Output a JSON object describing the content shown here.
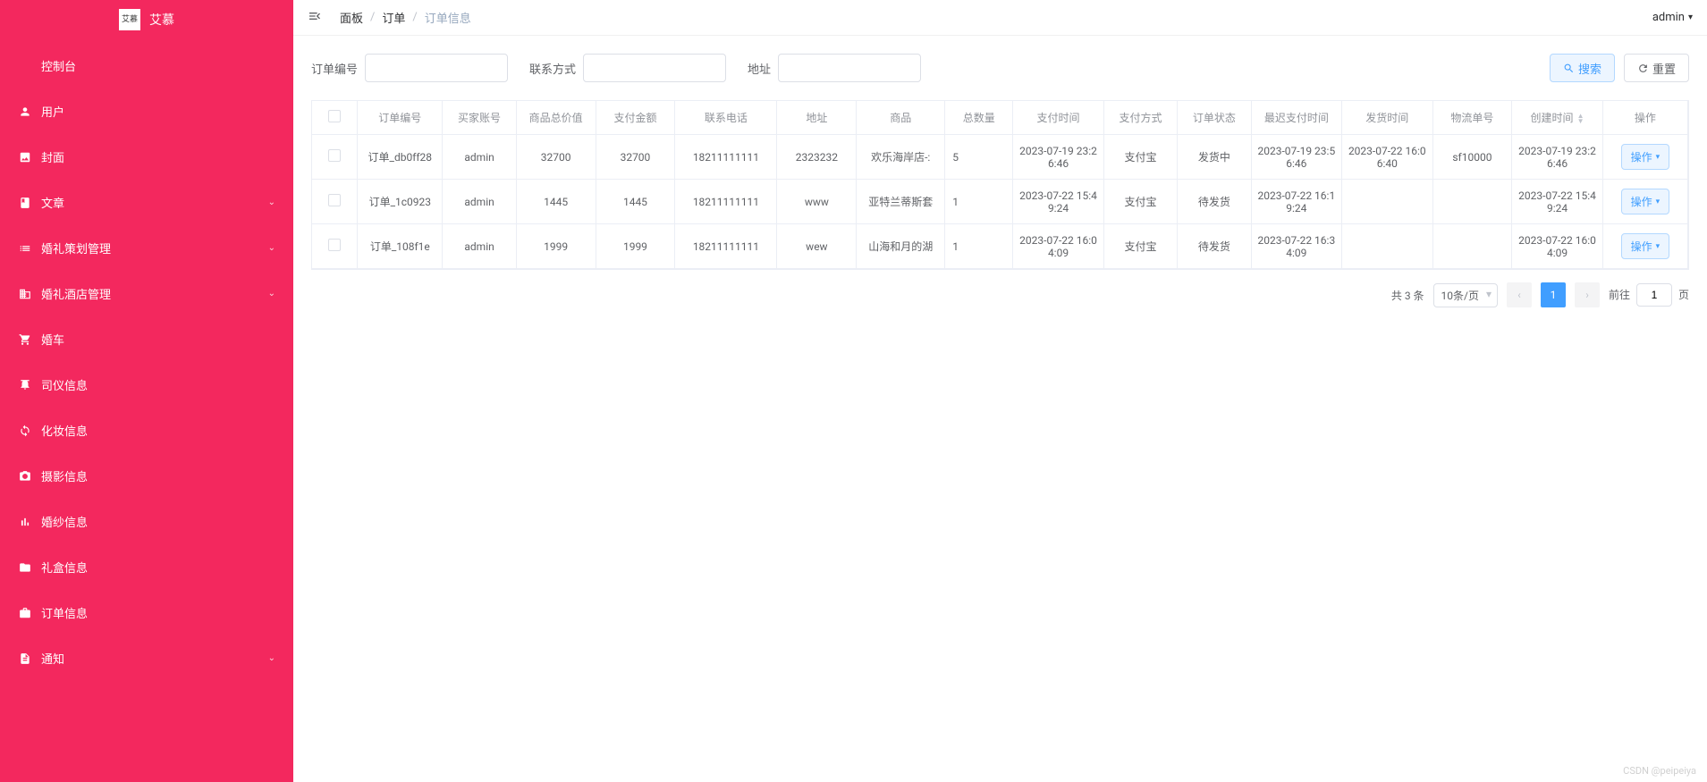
{
  "app": {
    "logo_text": "艾慕",
    "logo_inner": "艾慕"
  },
  "sidebar": {
    "items": [
      {
        "label": "控制台",
        "icon": "console",
        "expandable": false
      },
      {
        "label": "用户",
        "icon": "user",
        "expandable": false
      },
      {
        "label": "封面",
        "icon": "image",
        "expandable": false
      },
      {
        "label": "文章",
        "icon": "book",
        "expandable": true
      },
      {
        "label": "婚礼策划管理",
        "icon": "list",
        "expandable": true
      },
      {
        "label": "婚礼酒店管理",
        "icon": "building",
        "expandable": true
      },
      {
        "label": "婚车",
        "icon": "cart",
        "expandable": false
      },
      {
        "label": "司仪信息",
        "icon": "mic",
        "expandable": false
      },
      {
        "label": "化妆信息",
        "icon": "refresh",
        "expandable": false
      },
      {
        "label": "摄影信息",
        "icon": "camera",
        "expandable": false
      },
      {
        "label": "婚纱信息",
        "icon": "chart",
        "expandable": false
      },
      {
        "label": "礼盒信息",
        "icon": "folder",
        "expandable": false
      },
      {
        "label": "订单信息",
        "icon": "order",
        "expandable": false
      },
      {
        "label": "通知",
        "icon": "doc",
        "expandable": true
      }
    ]
  },
  "header": {
    "breadcrumb": [
      "面板",
      "订单",
      "订单信息"
    ],
    "user": "admin"
  },
  "search": {
    "fields": [
      {
        "label": "订单编号"
      },
      {
        "label": "联系方式"
      },
      {
        "label": "地址"
      }
    ],
    "search_btn": "搜索",
    "reset_btn": "重置"
  },
  "table": {
    "columns": [
      "订单编号",
      "买家账号",
      "商品总价值",
      "支付金额",
      "联系电话",
      "地址",
      "商品",
      "总数量",
      "支付时间",
      "支付方式",
      "订单状态",
      "最迟支付时间",
      "发货时间",
      "物流单号",
      "创建时间",
      "操作"
    ],
    "rows": [
      {
        "order_no": "订单_db0ff28",
        "buyer": "admin",
        "total": "32700",
        "paid": "32700",
        "phone": "18211111111",
        "addr": "2323232",
        "product": "欢乐海岸店-:",
        "qty": "5",
        "pay_time": "2023-07-19 23:26:46",
        "pay_method": "支付宝",
        "status": "发货中",
        "latest_pay": "2023-07-19 23:56:46",
        "ship_time": "2023-07-22 16:06:40",
        "tracking": "sf10000",
        "created": "2023-07-19 23:26:46"
      },
      {
        "order_no": "订单_1c0923",
        "buyer": "admin",
        "total": "1445",
        "paid": "1445",
        "phone": "18211111111",
        "addr": "www",
        "product": "亚特兰蒂斯套",
        "qty": "1",
        "pay_time": "2023-07-22 15:49:24",
        "pay_method": "支付宝",
        "status": "待发货",
        "latest_pay": "2023-07-22 16:19:24",
        "ship_time": "",
        "tracking": "",
        "created": "2023-07-22 15:49:24"
      },
      {
        "order_no": "订单_108f1e",
        "buyer": "admin",
        "total": "1999",
        "paid": "1999",
        "phone": "18211111111",
        "addr": "wew",
        "product": "山海和月的湖",
        "qty": "1",
        "pay_time": "2023-07-22 16:04:09",
        "pay_method": "支付宝",
        "status": "待发货",
        "latest_pay": "2023-07-22 16:34:09",
        "ship_time": "",
        "tracking": "",
        "created": "2023-07-22 16:04:09"
      }
    ],
    "action_label": "操作"
  },
  "pagination": {
    "total_text": "共 3 条",
    "page_size": "10条/页",
    "current": "1",
    "jump_prefix": "前往",
    "jump_value": "1",
    "jump_suffix": "页"
  },
  "watermark": "CSDN @peipeiya"
}
